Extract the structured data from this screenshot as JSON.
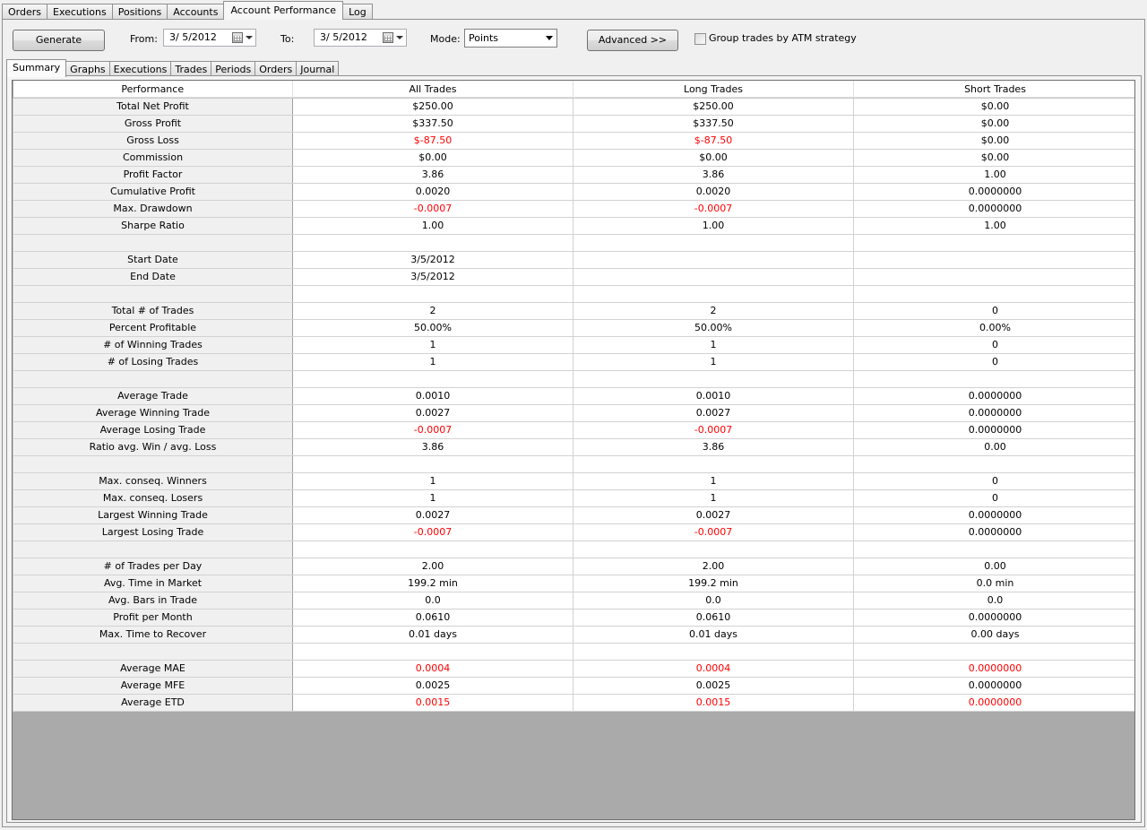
{
  "top_tabs": [
    "Orders",
    "Executions",
    "Positions",
    "Accounts",
    "Account Performance",
    "Log"
  ],
  "active_top_tab": "Account Performance",
  "toolbar": {
    "generate_label": "Generate",
    "from_label": "From:",
    "from_value": "3/  5/2012",
    "to_label": "To:",
    "to_value": "3/  5/2012",
    "mode_label": "Mode:",
    "mode_value": "Points",
    "advanced_label": "Advanced >>",
    "group_trades_label": "Group trades by ATM strategy",
    "group_trades_checked": false
  },
  "sub_tabs": [
    "Summary",
    "Graphs",
    "Executions",
    "Trades",
    "Periods",
    "Orders",
    "Journal"
  ],
  "active_sub_tab": "Summary",
  "negative_color": "#ff0000",
  "table": {
    "headers": [
      "Performance",
      "All Trades",
      "Long Trades",
      "Short Trades"
    ],
    "rows": [
      [
        "Total Net Profit",
        "$250.00",
        "$250.00",
        "$0.00"
      ],
      [
        "Gross Profit",
        "$337.50",
        "$337.50",
        "$0.00"
      ],
      [
        "Gross Loss",
        "$-87.50",
        "$-87.50",
        "$0.00"
      ],
      [
        "Commission",
        "$0.00",
        "$0.00",
        "$0.00"
      ],
      [
        "Profit Factor",
        "3.86",
        "3.86",
        "1.00"
      ],
      [
        "Cumulative Profit",
        "0.0020",
        "0.0020",
        "0.0000000"
      ],
      [
        "Max. Drawdown",
        "-0.0007",
        "-0.0007",
        "0.0000000"
      ],
      [
        "Sharpe Ratio",
        "1.00",
        "1.00",
        "1.00"
      ],
      [
        "",
        "",
        "",
        ""
      ],
      [
        "Start Date",
        "3/5/2012",
        "",
        ""
      ],
      [
        "End Date",
        "3/5/2012",
        "",
        ""
      ],
      [
        "",
        "",
        "",
        ""
      ],
      [
        "Total # of Trades",
        "2",
        "2",
        "0"
      ],
      [
        "Percent Profitable",
        "50.00%",
        "50.00%",
        "0.00%"
      ],
      [
        "# of Winning Trades",
        "1",
        "1",
        "0"
      ],
      [
        "# of Losing Trades",
        "1",
        "1",
        "0"
      ],
      [
        "",
        "",
        "",
        ""
      ],
      [
        "Average Trade",
        "0.0010",
        "0.0010",
        "0.0000000"
      ],
      [
        "Average Winning Trade",
        "0.0027",
        "0.0027",
        "0.0000000"
      ],
      [
        "Average Losing Trade",
        "-0.0007",
        "-0.0007",
        "0.0000000"
      ],
      [
        "Ratio avg. Win / avg. Loss",
        "3.86",
        "3.86",
        "0.00"
      ],
      [
        "",
        "",
        "",
        ""
      ],
      [
        "Max. conseq. Winners",
        "1",
        "1",
        "0"
      ],
      [
        "Max. conseq. Losers",
        "1",
        "1",
        "0"
      ],
      [
        "Largest Winning Trade",
        "0.0027",
        "0.0027",
        "0.0000000"
      ],
      [
        "Largest Losing Trade",
        "-0.0007",
        "-0.0007",
        "0.0000000"
      ],
      [
        "",
        "",
        "",
        ""
      ],
      [
        "# of Trades per Day",
        "2.00",
        "2.00",
        "0.00"
      ],
      [
        "Avg. Time in Market",
        "199.2 min",
        "199.2 min",
        "0.0 min"
      ],
      [
        "Avg. Bars in Trade",
        "0.0",
        "0.0",
        "0.0"
      ],
      [
        "Profit per Month",
        "0.0610",
        "0.0610",
        "0.0000000"
      ],
      [
        "Max. Time to Recover",
        "0.01 days",
        "0.01 days",
        "0.00 days"
      ],
      [
        "",
        "",
        "",
        ""
      ],
      [
        "Average MAE",
        "0.0004",
        "0.0004",
        "0.0000000"
      ],
      [
        "Average MFE",
        "0.0025",
        "0.0025",
        "0.0000000"
      ],
      [
        "Average ETD",
        "0.0015",
        "0.0015",
        "0.0000000"
      ]
    ],
    "red_rows": [
      "Gross Loss",
      "Max. Drawdown",
      "Average Losing Trade",
      "Largest Losing Trade",
      "Average MAE",
      "Average ETD"
    ],
    "red_columns_all": [
      "Average MAE",
      "Average ETD"
    ]
  }
}
